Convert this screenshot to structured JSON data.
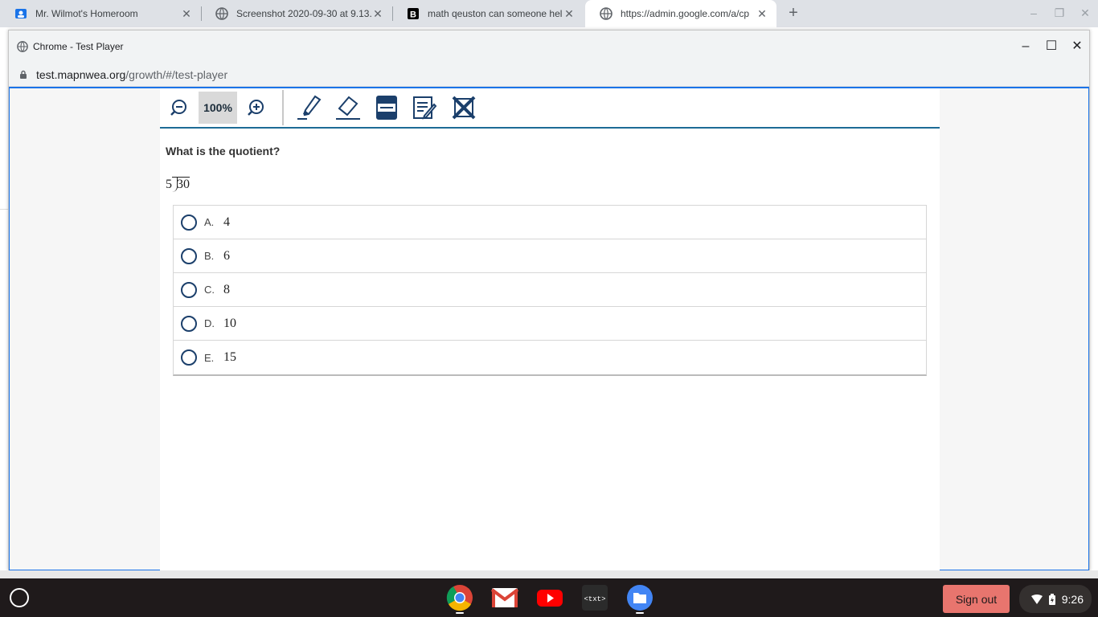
{
  "browser": {
    "tabs": [
      {
        "title": "Mr. Wilmot's Homeroom",
        "icon": "classroom-icon"
      },
      {
        "title": "Screenshot 2020-09-30 at 9.13.4",
        "icon": "globe-icon"
      },
      {
        "title": "math qeuston can someone help",
        "icon": "brainly-icon"
      },
      {
        "title": "https://admin.google.com/a/cp",
        "icon": "globe-icon",
        "active": true
      }
    ]
  },
  "popup": {
    "title": "Chrome - Test Player",
    "url_domain": "test.mapnwea.org",
    "url_path": "/growth/#/test-player"
  },
  "toolbar": {
    "zoom_level": "100%"
  },
  "question": {
    "prompt": "What is the quotient?",
    "divisor": "5",
    "dividend": "30",
    "choices": [
      {
        "letter": "A.",
        "value": "4"
      },
      {
        "letter": "B.",
        "value": "6"
      },
      {
        "letter": "C.",
        "value": "8"
      },
      {
        "letter": "D.",
        "value": "10"
      },
      {
        "letter": "E.",
        "value": "15"
      }
    ]
  },
  "shelf": {
    "sign_out": "Sign out",
    "time": "9:26"
  },
  "colors": {
    "accent": "#1d6b96",
    "sign_out_bg": "#e8756e"
  }
}
